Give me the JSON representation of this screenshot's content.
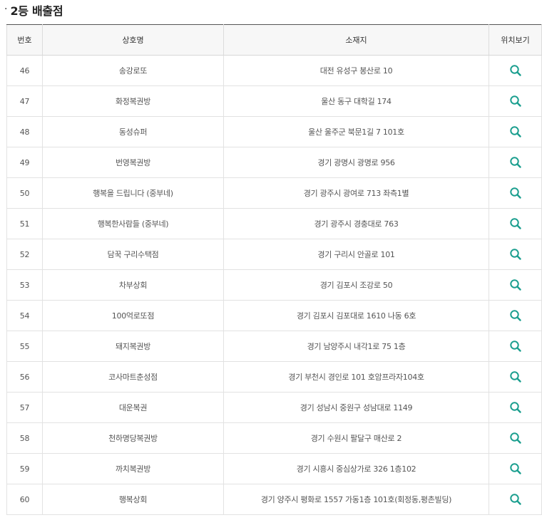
{
  "section": {
    "bullet": "·",
    "title": "2등 배출점"
  },
  "table": {
    "headers": {
      "no": "번호",
      "name": "상호명",
      "address": "소재지",
      "map": "위치보기"
    },
    "rows": [
      {
        "no": "46",
        "name": "송강로또",
        "address": "대전 유성구 봉산로 10"
      },
      {
        "no": "47",
        "name": "화정복권방",
        "address": "울산 동구 대학길 174"
      },
      {
        "no": "48",
        "name": "동성슈퍼",
        "address": "울산 울주군 북문1길 7 101호"
      },
      {
        "no": "49",
        "name": "번영복권방",
        "address": "경기 광명시 광명로 956"
      },
      {
        "no": "50",
        "name": "행복을 드립니다 (중부네)",
        "address": "경기 광주시 광여로 713 좌측1별"
      },
      {
        "no": "51",
        "name": "행복한사람들 (중부네)",
        "address": "경기 광주시 경충대로 763"
      },
      {
        "no": "52",
        "name": "담꾹 구리수택점",
        "address": "경기 구리시 안골로 101"
      },
      {
        "no": "53",
        "name": "차부상회",
        "address": "경기 김포시 조강로 50"
      },
      {
        "no": "54",
        "name": "100억로또점",
        "address": "경기 김포시 김포대로 1610 나동 6호"
      },
      {
        "no": "55",
        "name": "돼지복권방",
        "address": "경기 남양주시 내각1로 75 1층"
      },
      {
        "no": "56",
        "name": "코사마트춘성점",
        "address": "경기 부천시 경인로 101 호암프라자104호"
      },
      {
        "no": "57",
        "name": "대운복권",
        "address": "경기 성남시 중원구 성남대로 1149"
      },
      {
        "no": "58",
        "name": "천하명당복권방",
        "address": "경기 수원시 팔달구 매산로 2"
      },
      {
        "no": "59",
        "name": "까치복권방",
        "address": "경기 시흥시 중심상가로 326 1층102"
      },
      {
        "no": "60",
        "name": "행복상회",
        "address": "경기 양주시 평화로 1557 가동1층 101호(회정동,평촌빌딩)"
      }
    ]
  },
  "icons": {
    "map": "search-icon",
    "color": "#1a9e8e"
  }
}
